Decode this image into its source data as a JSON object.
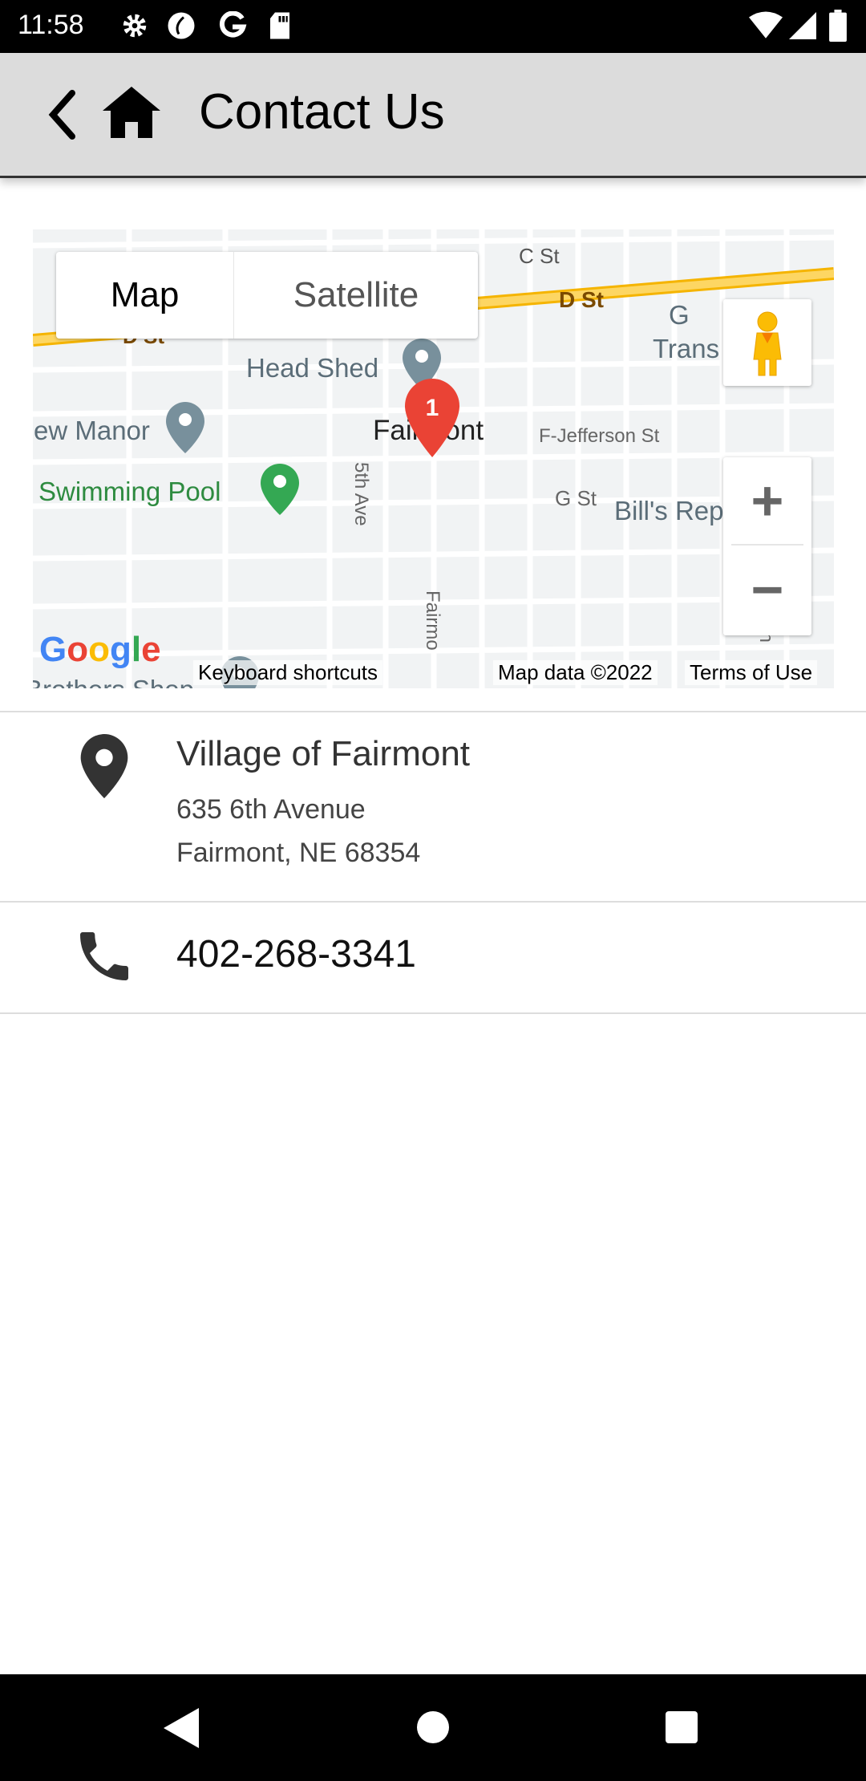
{
  "status_bar": {
    "time": "11:58",
    "icons": [
      "gear-icon",
      "sync-icon",
      "google-icon",
      "sd-card-icon",
      "wifi-icon",
      "signal-icon",
      "battery-icon"
    ]
  },
  "app_bar": {
    "title": "Contact Us",
    "back_icon": "chevron-left-icon",
    "home_icon": "home-icon"
  },
  "map": {
    "type_toggle": {
      "map": "Map",
      "satellite": "Satellite",
      "selected": "Map"
    },
    "marker_label": "1",
    "marker_color": "#ea4335",
    "labels": {
      "c_st": "C St",
      "d_st": "D St",
      "d_st_left": "D St",
      "head_shed": "Head Shed",
      "fairmont": "Fairmont",
      "f_jefferson": "F-Jefferson St",
      "manor": "ew Manor",
      "swimming_pool": "Swimming Pool",
      "fifth_ave": "5th Ave",
      "g_st": "G St",
      "bills": "Bill's Rep",
      "trans": "Trans",
      "g_letter": "G",
      "fairmont_ave": "Fairmo",
      "brothers": "Brothers Shop",
      "th": "th"
    },
    "logo": "Google",
    "attribution": {
      "shortcuts": "Keyboard shortcuts",
      "data": "Map data ©2022",
      "terms": "Terms of Use"
    },
    "zoom_in": "+",
    "zoom_out": "−"
  },
  "address": {
    "name": "Village of Fairmont",
    "line1": "635 6th Avenue",
    "line2": "Fairmont, NE  68354",
    "icon": "map-pin-icon"
  },
  "phone": {
    "number": "402-268-3341",
    "icon": "phone-icon"
  },
  "nav_bar": {
    "icons": [
      "back-triangle-icon",
      "home-circle-icon",
      "recents-square-icon"
    ]
  }
}
